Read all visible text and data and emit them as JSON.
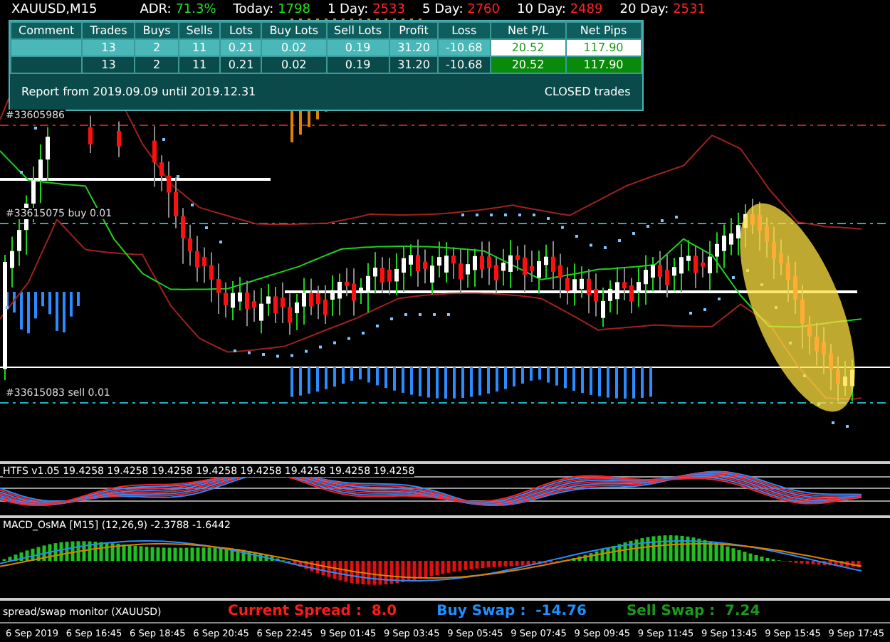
{
  "chart_title": "XAUUSD,M15",
  "adr": [
    {
      "label": "ADR:",
      "value": "71.3%",
      "color": "#22dd22"
    },
    {
      "label": "Today:",
      "value": "1798",
      "color": "#22dd22"
    },
    {
      "label": "1 Day:",
      "value": "2533",
      "color": "#ff2222"
    },
    {
      "label": "5 Day:",
      "value": "2760",
      "color": "#ff2222"
    },
    {
      "label": "10 Day:",
      "value": "2489",
      "color": "#ff2222"
    },
    {
      "label": "20 Day:",
      "value": "2531",
      "color": "#ff2222"
    }
  ],
  "table": {
    "columns": [
      "Comment",
      "Trades",
      "Buys",
      "Sells",
      "Lots",
      "Buy Lots",
      "Sell Lots",
      "Profit",
      "Loss",
      "Net P/L",
      "Net Pips"
    ],
    "rows": [
      {
        "highlighted": true,
        "cells": [
          "",
          "13",
          "2",
          "11",
          "0.21",
          "0.02",
          "0.19",
          "31.20",
          "-10.68",
          "20.52",
          "117.90"
        ]
      },
      {
        "highlighted": false,
        "cells": [
          "",
          "13",
          "2",
          "11",
          "0.21",
          "0.02",
          "0.19",
          "31.20",
          "-10.68",
          "20.52",
          "117.90"
        ]
      }
    ],
    "report": "Report from 2019.09.09 until 2019.12.31",
    "report_type": "CLOSED trades"
  },
  "order_labels": [
    {
      "text": "#33605986",
      "kind": "closed"
    },
    {
      "text": "#33615075 buy 0.01",
      "kind": "buy"
    },
    {
      "text": "#33615083 sell 0.01",
      "kind": "sell"
    }
  ],
  "htfs_label": "HTFS v1.05 19.4258 19.4258 19.4258 19.4258 19.4258 19.4258 19.4258 19.4258",
  "macd_label": "MACD_OsMA [M15] (12,26,9) -2.3788 -1.6442",
  "monitor": {
    "title": "spread/swap monitor (XAUUSD)",
    "items": [
      {
        "label": "Current Spread :",
        "value": "8.0",
        "color": "#ff1a1a"
      },
      {
        "label": "Buy Swap :",
        "value": "-14.76",
        "color": "#1e90ff"
      },
      {
        "label": "Sell Swap :",
        "value": "7.24",
        "color": "#1a9a1a"
      }
    ]
  },
  "time_axis": [
    "6 Sep 2019",
    "6 Sep 16:45",
    "6 Sep 18:45",
    "6 Sep 20:45",
    "6 Sep 22:45",
    "9 Sep 01:45",
    "9 Sep 03:45",
    "9 Sep 05:45",
    "9 Sep 07:45",
    "9 Sep 09:45",
    "9 Sep 11:45",
    "9 Sep 13:45",
    "9 Sep 15:45",
    "9 Sep 17:45"
  ]
}
